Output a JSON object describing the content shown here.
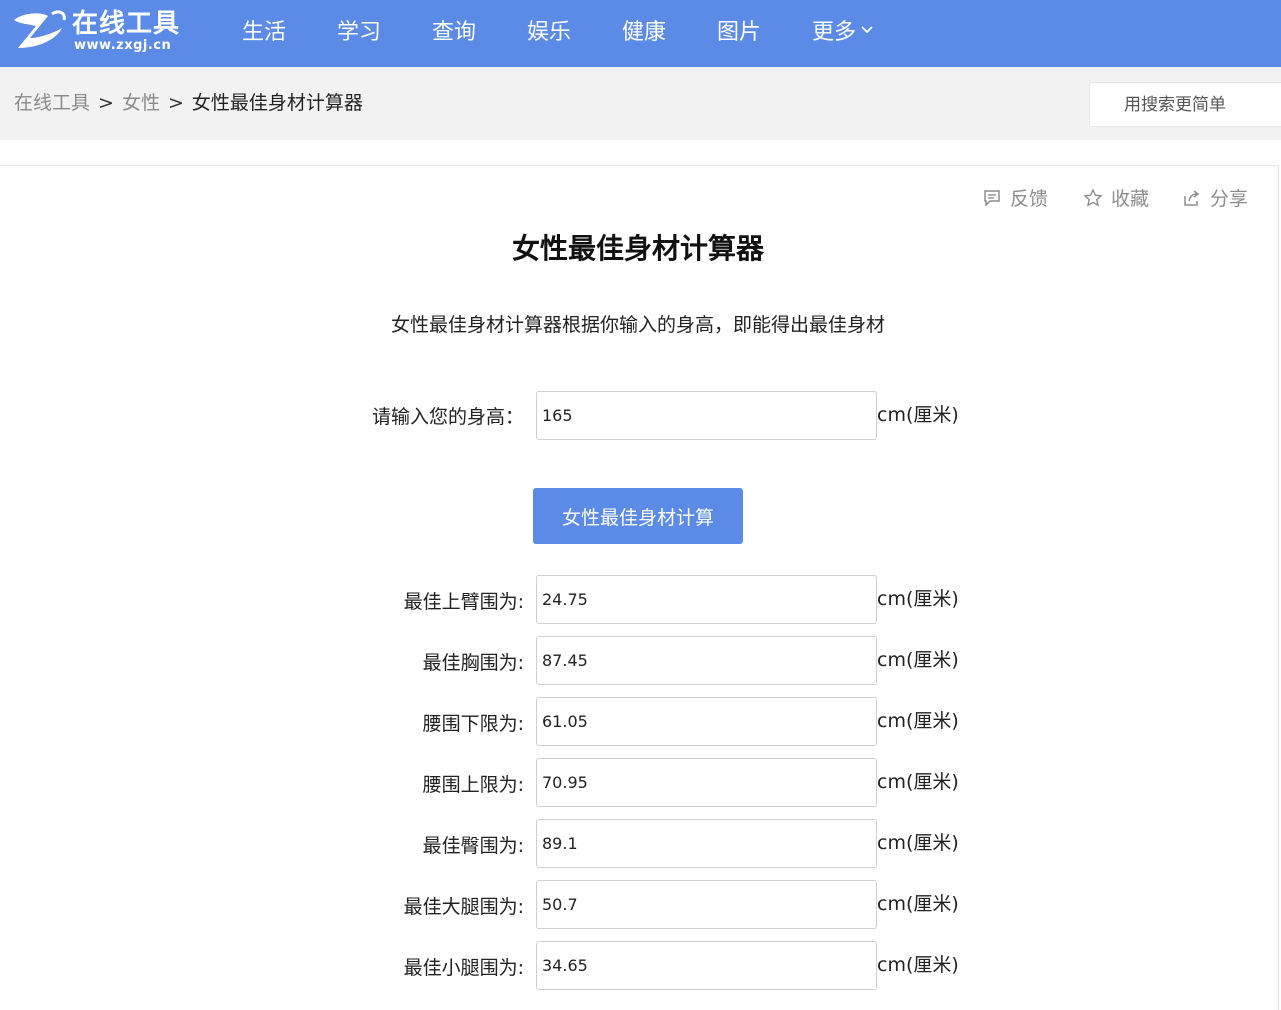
{
  "header": {
    "logo_text": "在线工具",
    "logo_sub": "www.zxgj.cn",
    "nav": [
      "生活",
      "学习",
      "查询",
      "娱乐",
      "健康",
      "图片"
    ],
    "more_label": "更多"
  },
  "breadcrumb": {
    "home": "在线工具",
    "category": "女性",
    "current": "女性最佳身材计算器",
    "separator": ">"
  },
  "search": {
    "placeholder": "用搜索更简单"
  },
  "toolbar": {
    "feedback": "反馈",
    "favorite": "收藏",
    "share": "分享"
  },
  "main": {
    "title": "女性最佳身材计算器",
    "description": "女性最佳身材计算器根据你输入的身高，即能得出最佳身材",
    "height_label": "请输入您的身高：",
    "height_value": "165",
    "unit": "cm(厘米)",
    "button_label": "女性最佳身材计算",
    "results": [
      {
        "label": "最佳上臂围为:",
        "value": "24.75"
      },
      {
        "label": "最佳胸围为:",
        "value": "87.45"
      },
      {
        "label": "腰围下限为:",
        "value": "61.05"
      },
      {
        "label": "腰围上限为:",
        "value": "70.95"
      },
      {
        "label": "最佳臀围为:",
        "value": "89.1"
      },
      {
        "label": "最佳大腿围为:",
        "value": "50.7"
      },
      {
        "label": "最佳小腿围为:",
        "value": "34.65"
      }
    ]
  },
  "colors": {
    "brand": "#5b8be6",
    "crumb_bg": "#f2f2f2",
    "muted": "#8d8d8d"
  }
}
